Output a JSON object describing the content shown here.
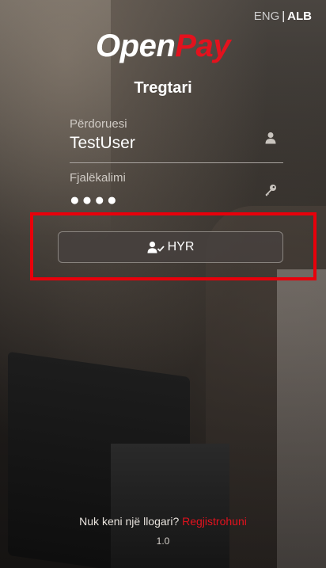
{
  "header": {
    "lang_en": "ENG",
    "lang_separator": "|",
    "lang_al": "ALB",
    "active_language": "ALB"
  },
  "brand": {
    "logo_part1": "Open",
    "logo_part2": "Pay",
    "logo_colors": {
      "part1": "#ffffff",
      "part2": "#e3121e"
    }
  },
  "subtitle": "Tregtari",
  "form": {
    "username": {
      "label": "Përdoruesi",
      "value": "TestUser",
      "icon": "user-icon"
    },
    "password": {
      "label": "Fjalëkalimi",
      "value": "●●●●",
      "icon": "key-icon"
    },
    "login_button": {
      "label": "HYR",
      "icon": "user-check-icon"
    }
  },
  "footer": {
    "prompt": "Nuk keni një llogari?",
    "register_link": "Regjistrohuni",
    "version": "1.0"
  },
  "colors": {
    "accent": "#e3121e",
    "highlight": "#e8000b"
  }
}
